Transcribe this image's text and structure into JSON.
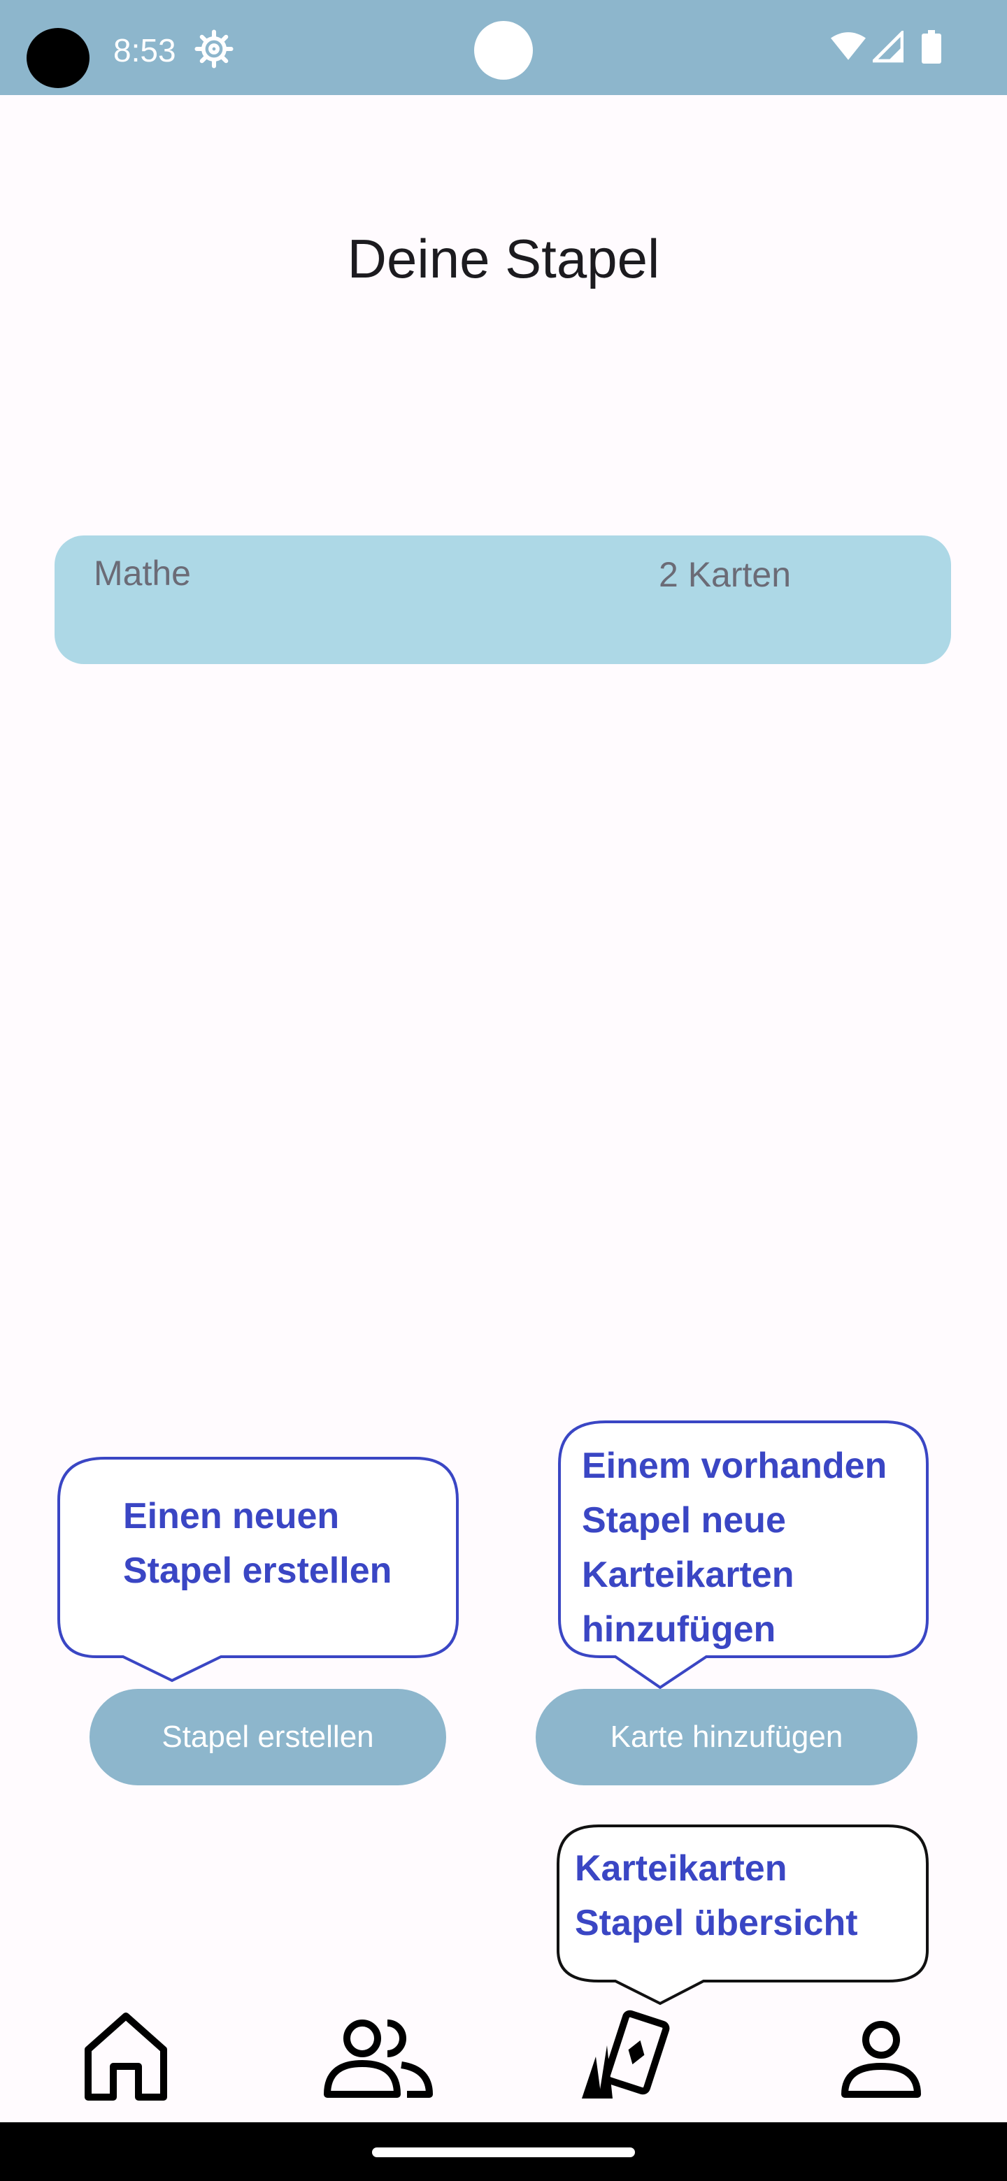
{
  "status_bar": {
    "time": "8:53",
    "icons": [
      "camera-hole",
      "gear-icon",
      "wifi-icon",
      "signal-icon",
      "battery-icon"
    ]
  },
  "page": {
    "title": "Deine Stapel"
  },
  "decks": [
    {
      "name": "Mathe",
      "count": "2 Karten"
    }
  ],
  "buttons": {
    "create_deck": "Stapel erstellen",
    "add_card": "Karte hinzufügen"
  },
  "callouts": {
    "create_deck": [
      "Einen neuen",
      "Stapel erstellen"
    ],
    "add_card": [
      "Einem vorhanden",
      "Stapel neue",
      "Karteikarten",
      "hinzufügen"
    ],
    "overview": [
      "Karteikarten",
      "Stapel übersicht"
    ]
  },
  "bottom_nav": {
    "items": [
      "home-icon",
      "group-icon",
      "cards-icon",
      "profile-icon"
    ]
  },
  "colors": {
    "status_bar": "#8db6cc",
    "deck_card": "#add8e6",
    "button": "#8db6cc",
    "callout_text": "#3a46c4",
    "background": "#fffbfe"
  }
}
